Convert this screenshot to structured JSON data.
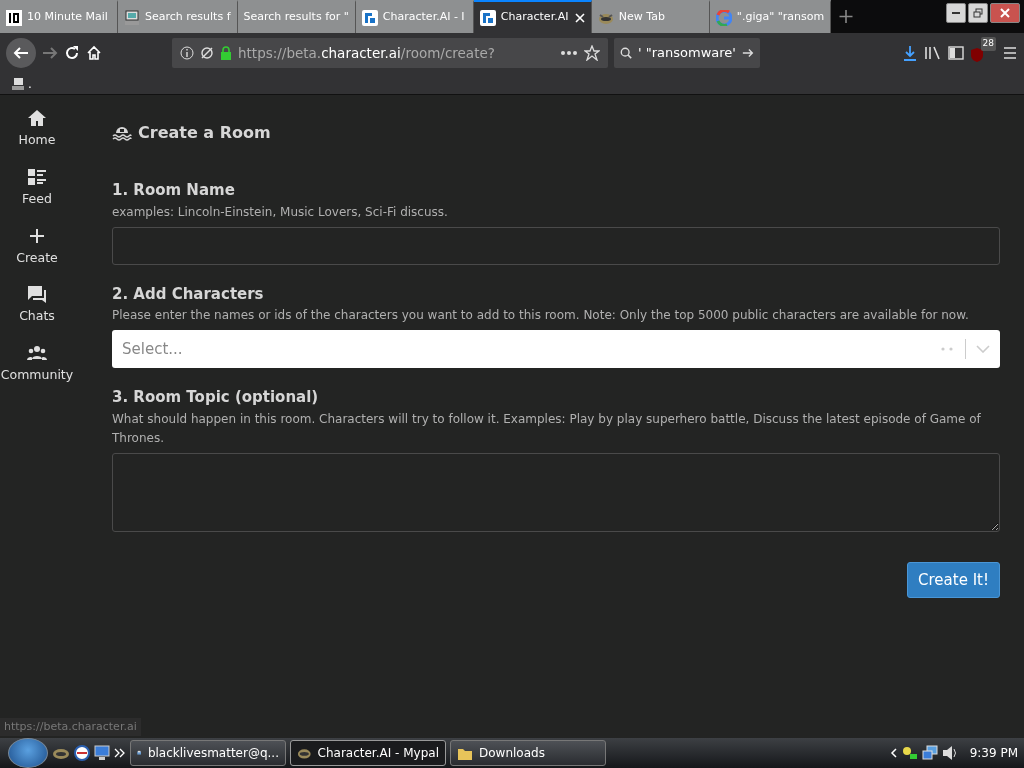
{
  "browser": {
    "tabs": [
      {
        "title": "10 Minute Mail",
        "selected": false
      },
      {
        "title": "Search results f",
        "selected": false
      },
      {
        "title": "Search results for \"",
        "selected": false
      },
      {
        "title": "Character.AI - I",
        "selected": false
      },
      {
        "title": "Character.AI",
        "selected": true
      },
      {
        "title": "New Tab",
        "selected": false
      },
      {
        "title": "\".giga\" \"ransom",
        "selected": false
      }
    ],
    "url": "https://beta.**character.ai**/room/create?",
    "search_value": "' \"ransomware'",
    "addon_badge": "28",
    "bookmark": "."
  },
  "sidebar": {
    "items": [
      {
        "label": "Home"
      },
      {
        "label": "Feed"
      },
      {
        "label": "Create"
      },
      {
        "label": "Chats"
      },
      {
        "label": "Community"
      }
    ]
  },
  "page": {
    "title": "Create a Room",
    "sections": [
      {
        "heading": "1. Room Name",
        "hint": "examples: Lincoln-Einstein, Music Lovers, Sci-Fi discuss.",
        "kind": "text"
      },
      {
        "heading": "2. Add Characters",
        "hint": "Please enter the names or ids of the characters you want to add to this room. Note: Only the top 5000 public characters are available for now.",
        "kind": "select",
        "placeholder": "Select..."
      },
      {
        "heading": "3. Room Topic (optional)",
        "hint": "What should happen in this room. Characters will try to follow it. Examples: Play by play superhero battle, Discuss the latest episode of Game of Thrones.",
        "kind": "textarea"
      }
    ],
    "submit": "Create It!"
  },
  "status_text": "https://beta.character.ai",
  "taskbar": {
    "tasks": [
      {
        "label": "blacklivesmatter@q...",
        "selected": false
      },
      {
        "label": "Character.AI - Mypal",
        "selected": true
      },
      {
        "label": "Downloads",
        "selected": false
      }
    ],
    "clock": "9:39 PM"
  }
}
